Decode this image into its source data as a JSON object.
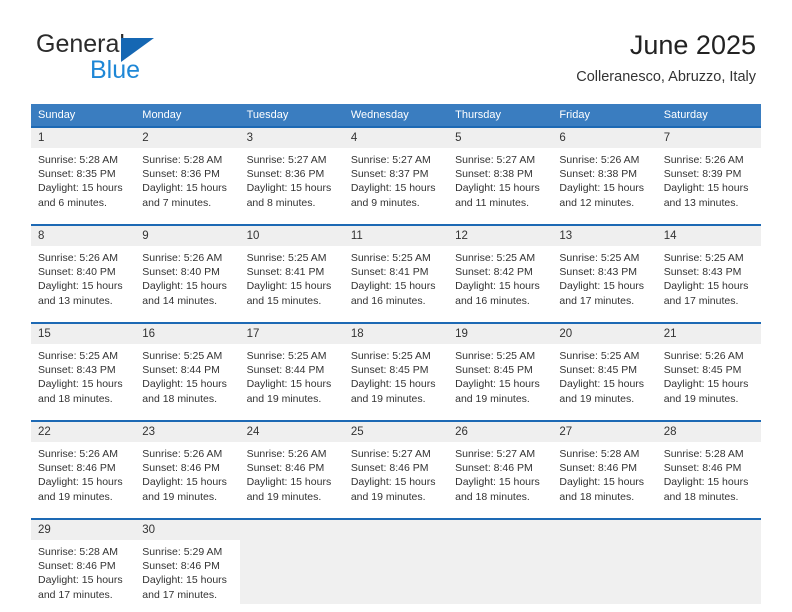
{
  "brand": {
    "name_part1": "General",
    "name_part2": "Blue",
    "accent_color": "#1e87d6",
    "triangle_color": "#1567b3"
  },
  "header": {
    "title": "June 2025",
    "subtitle": "Colleranesco, Abruzzo, Italy"
  },
  "calendar": {
    "header_bg": "#3a7dc0",
    "row_rule_color": "#1d69b4",
    "daynum_bg": "#efefef",
    "weekdays": [
      "Sunday",
      "Monday",
      "Tuesday",
      "Wednesday",
      "Thursday",
      "Friday",
      "Saturday"
    ],
    "weeks": [
      [
        {
          "day": "1",
          "sunrise": "Sunrise: 5:28 AM",
          "sunset": "Sunset: 8:35 PM",
          "daylight_1": "Daylight: 15 hours",
          "daylight_2": "and 6 minutes."
        },
        {
          "day": "2",
          "sunrise": "Sunrise: 5:28 AM",
          "sunset": "Sunset: 8:36 PM",
          "daylight_1": "Daylight: 15 hours",
          "daylight_2": "and 7 minutes."
        },
        {
          "day": "3",
          "sunrise": "Sunrise: 5:27 AM",
          "sunset": "Sunset: 8:36 PM",
          "daylight_1": "Daylight: 15 hours",
          "daylight_2": "and 8 minutes."
        },
        {
          "day": "4",
          "sunrise": "Sunrise: 5:27 AM",
          "sunset": "Sunset: 8:37 PM",
          "daylight_1": "Daylight: 15 hours",
          "daylight_2": "and 9 minutes."
        },
        {
          "day": "5",
          "sunrise": "Sunrise: 5:27 AM",
          "sunset": "Sunset: 8:38 PM",
          "daylight_1": "Daylight: 15 hours",
          "daylight_2": "and 11 minutes."
        },
        {
          "day": "6",
          "sunrise": "Sunrise: 5:26 AM",
          "sunset": "Sunset: 8:38 PM",
          "daylight_1": "Daylight: 15 hours",
          "daylight_2": "and 12 minutes."
        },
        {
          "day": "7",
          "sunrise": "Sunrise: 5:26 AM",
          "sunset": "Sunset: 8:39 PM",
          "daylight_1": "Daylight: 15 hours",
          "daylight_2": "and 13 minutes."
        }
      ],
      [
        {
          "day": "8",
          "sunrise": "Sunrise: 5:26 AM",
          "sunset": "Sunset: 8:40 PM",
          "daylight_1": "Daylight: 15 hours",
          "daylight_2": "and 13 minutes."
        },
        {
          "day": "9",
          "sunrise": "Sunrise: 5:26 AM",
          "sunset": "Sunset: 8:40 PM",
          "daylight_1": "Daylight: 15 hours",
          "daylight_2": "and 14 minutes."
        },
        {
          "day": "10",
          "sunrise": "Sunrise: 5:25 AM",
          "sunset": "Sunset: 8:41 PM",
          "daylight_1": "Daylight: 15 hours",
          "daylight_2": "and 15 minutes."
        },
        {
          "day": "11",
          "sunrise": "Sunrise: 5:25 AM",
          "sunset": "Sunset: 8:41 PM",
          "daylight_1": "Daylight: 15 hours",
          "daylight_2": "and 16 minutes."
        },
        {
          "day": "12",
          "sunrise": "Sunrise: 5:25 AM",
          "sunset": "Sunset: 8:42 PM",
          "daylight_1": "Daylight: 15 hours",
          "daylight_2": "and 16 minutes."
        },
        {
          "day": "13",
          "sunrise": "Sunrise: 5:25 AM",
          "sunset": "Sunset: 8:43 PM",
          "daylight_1": "Daylight: 15 hours",
          "daylight_2": "and 17 minutes."
        },
        {
          "day": "14",
          "sunrise": "Sunrise: 5:25 AM",
          "sunset": "Sunset: 8:43 PM",
          "daylight_1": "Daylight: 15 hours",
          "daylight_2": "and 17 minutes."
        }
      ],
      [
        {
          "day": "15",
          "sunrise": "Sunrise: 5:25 AM",
          "sunset": "Sunset: 8:43 PM",
          "daylight_1": "Daylight: 15 hours",
          "daylight_2": "and 18 minutes."
        },
        {
          "day": "16",
          "sunrise": "Sunrise: 5:25 AM",
          "sunset": "Sunset: 8:44 PM",
          "daylight_1": "Daylight: 15 hours",
          "daylight_2": "and 18 minutes."
        },
        {
          "day": "17",
          "sunrise": "Sunrise: 5:25 AM",
          "sunset": "Sunset: 8:44 PM",
          "daylight_1": "Daylight: 15 hours",
          "daylight_2": "and 19 minutes."
        },
        {
          "day": "18",
          "sunrise": "Sunrise: 5:25 AM",
          "sunset": "Sunset: 8:45 PM",
          "daylight_1": "Daylight: 15 hours",
          "daylight_2": "and 19 minutes."
        },
        {
          "day": "19",
          "sunrise": "Sunrise: 5:25 AM",
          "sunset": "Sunset: 8:45 PM",
          "daylight_1": "Daylight: 15 hours",
          "daylight_2": "and 19 minutes."
        },
        {
          "day": "20",
          "sunrise": "Sunrise: 5:25 AM",
          "sunset": "Sunset: 8:45 PM",
          "daylight_1": "Daylight: 15 hours",
          "daylight_2": "and 19 minutes."
        },
        {
          "day": "21",
          "sunrise": "Sunrise: 5:26 AM",
          "sunset": "Sunset: 8:45 PM",
          "daylight_1": "Daylight: 15 hours",
          "daylight_2": "and 19 minutes."
        }
      ],
      [
        {
          "day": "22",
          "sunrise": "Sunrise: 5:26 AM",
          "sunset": "Sunset: 8:46 PM",
          "daylight_1": "Daylight: 15 hours",
          "daylight_2": "and 19 minutes."
        },
        {
          "day": "23",
          "sunrise": "Sunrise: 5:26 AM",
          "sunset": "Sunset: 8:46 PM",
          "daylight_1": "Daylight: 15 hours",
          "daylight_2": "and 19 minutes."
        },
        {
          "day": "24",
          "sunrise": "Sunrise: 5:26 AM",
          "sunset": "Sunset: 8:46 PM",
          "daylight_1": "Daylight: 15 hours",
          "daylight_2": "and 19 minutes."
        },
        {
          "day": "25",
          "sunrise": "Sunrise: 5:27 AM",
          "sunset": "Sunset: 8:46 PM",
          "daylight_1": "Daylight: 15 hours",
          "daylight_2": "and 19 minutes."
        },
        {
          "day": "26",
          "sunrise": "Sunrise: 5:27 AM",
          "sunset": "Sunset: 8:46 PM",
          "daylight_1": "Daylight: 15 hours",
          "daylight_2": "and 18 minutes."
        },
        {
          "day": "27",
          "sunrise": "Sunrise: 5:28 AM",
          "sunset": "Sunset: 8:46 PM",
          "daylight_1": "Daylight: 15 hours",
          "daylight_2": "and 18 minutes."
        },
        {
          "day": "28",
          "sunrise": "Sunrise: 5:28 AM",
          "sunset": "Sunset: 8:46 PM",
          "daylight_1": "Daylight: 15 hours",
          "daylight_2": "and 18 minutes."
        }
      ],
      [
        {
          "day": "29",
          "sunrise": "Sunrise: 5:28 AM",
          "sunset": "Sunset: 8:46 PM",
          "daylight_1": "Daylight: 15 hours",
          "daylight_2": "and 17 minutes."
        },
        {
          "day": "30",
          "sunrise": "Sunrise: 5:29 AM",
          "sunset": "Sunset: 8:46 PM",
          "daylight_1": "Daylight: 15 hours",
          "daylight_2": "and 17 minutes."
        },
        null,
        null,
        null,
        null,
        null
      ]
    ]
  }
}
